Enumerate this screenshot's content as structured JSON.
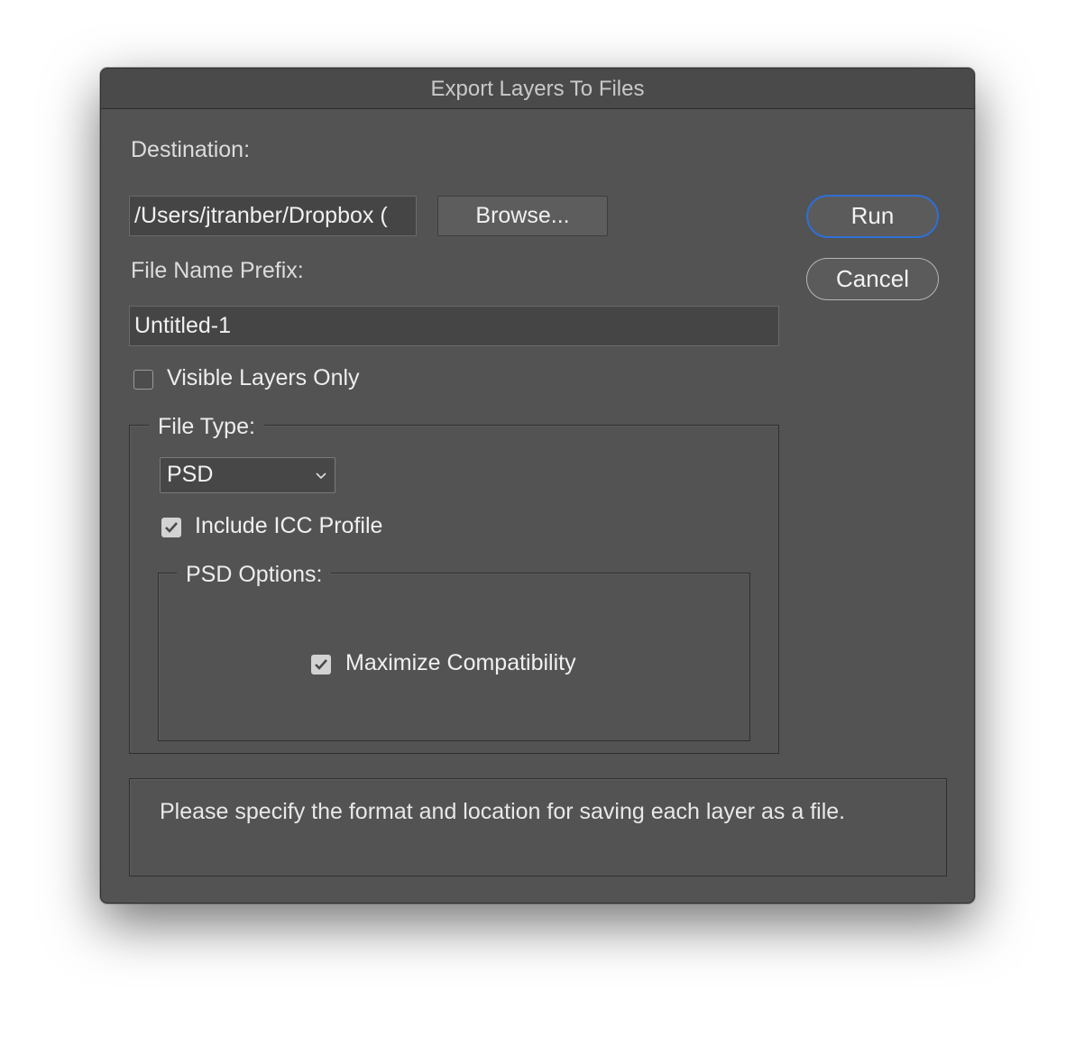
{
  "window": {
    "title": "Export Layers To Files"
  },
  "destination": {
    "label": "Destination:",
    "path_value": "/Users/jtranber/Dropbox (",
    "browse_label": "Browse..."
  },
  "actions": {
    "run_label": "Run",
    "cancel_label": "Cancel"
  },
  "prefix": {
    "label": "File Name Prefix:",
    "value": "Untitled-1"
  },
  "visible_layers_only": {
    "label": "Visible Layers Only",
    "checked": false
  },
  "file_type": {
    "legend": "File Type:",
    "selected": "PSD",
    "include_icc": {
      "label": "Include ICC Profile",
      "checked": true
    }
  },
  "psd_options": {
    "legend": "PSD Options:",
    "maximize_compatibility": {
      "label": "Maximize Compatibility",
      "checked": true
    }
  },
  "message": "Please specify the format and location for saving each layer as a file.",
  "colors": {
    "panel": "#535353",
    "default_button_ring": "#2f6fd3",
    "titlebar": "#4a4a4a"
  },
  "icons": {
    "checkmark": "checkmark-icon",
    "dropdown": "chevron-down-icon"
  }
}
